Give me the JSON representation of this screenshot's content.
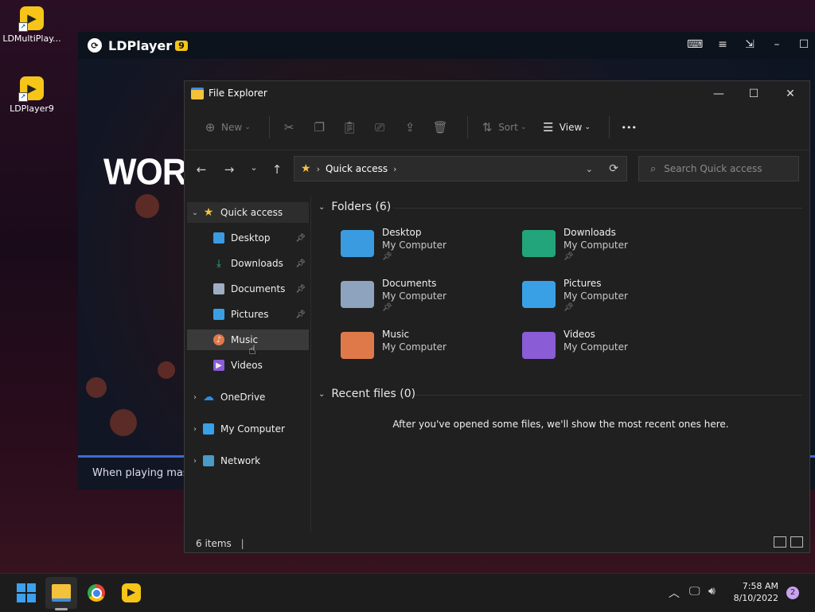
{
  "desktop": {
    "icons": [
      {
        "label": "LDMultiPlay..."
      },
      {
        "label": "LDPlayer9"
      }
    ]
  },
  "ldplayer": {
    "name": "LDPlayer",
    "badge": "9",
    "headline": "WORLD",
    "subtitle": "When playing massi"
  },
  "explorer": {
    "title": "File Explorer",
    "toolbar": {
      "new_label": "New",
      "sort_label": "Sort",
      "view_label": "View",
      "more": "•••"
    },
    "address": {
      "location": "Quick access"
    },
    "search": {
      "placeholder": "Search Quick access"
    },
    "sidebar": {
      "quick_access": "Quick access",
      "items": [
        {
          "label": "Desktop"
        },
        {
          "label": "Downloads"
        },
        {
          "label": "Documents"
        },
        {
          "label": "Pictures"
        },
        {
          "label": "Music"
        },
        {
          "label": "Videos"
        }
      ],
      "onedrive": "OneDrive",
      "mycomputer": "My Computer",
      "network": "Network"
    },
    "folders_header": "Folders (6)",
    "folders": [
      {
        "name": "Desktop",
        "location": "My Computer",
        "color": "#3a9be0"
      },
      {
        "name": "Downloads",
        "location": "My Computer",
        "color": "#22a57a"
      },
      {
        "name": "Documents",
        "location": "My Computer",
        "color": "#8ea3bd"
      },
      {
        "name": "Pictures",
        "location": "My Computer",
        "color": "#3aa0e6"
      },
      {
        "name": "Music",
        "location": "My Computer",
        "color": "#e0794a"
      },
      {
        "name": "Videos",
        "location": "My Computer",
        "color": "#8a5cd6"
      }
    ],
    "recent_header": "Recent files (0)",
    "recent_empty": "After you've opened some files, we'll show the most recent ones here.",
    "status": "6 items"
  },
  "taskbar": {
    "time": "7:58 AM",
    "date": "8/10/2022",
    "notifications": "2"
  }
}
